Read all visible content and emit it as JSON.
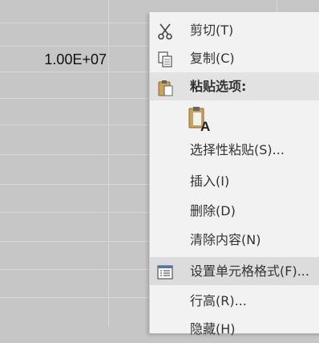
{
  "sheet": {
    "cell_value": "1.00E+07"
  },
  "context_menu": {
    "items": [
      {
        "label": "剪切(T)",
        "icon": "scissors-icon"
      },
      {
        "label": "复制(C)",
        "icon": "copy-icon"
      },
      {
        "label": "粘贴选项:",
        "icon": "clipboard-icon"
      },
      {
        "label": "选择性粘贴(S)..."
      },
      {
        "label": "插入(I)"
      },
      {
        "label": "删除(D)"
      },
      {
        "label": "清除内容(N)"
      },
      {
        "label": "设置单元格格式(F)...",
        "icon": "format-cells-icon"
      },
      {
        "label": "行高(R)..."
      },
      {
        "label": "隐藏(H)"
      }
    ],
    "paste_option_icon": "paste-text-only-icon",
    "paste_option_letter": "A"
  }
}
